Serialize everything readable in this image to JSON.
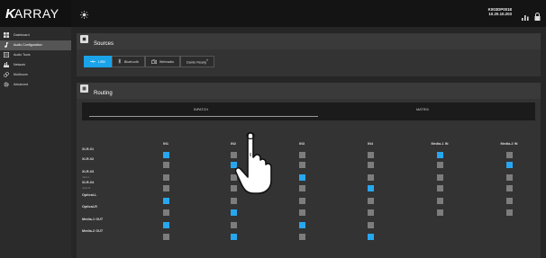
{
  "app": {
    "logo_k": "K",
    "logo_rest": "ARRAY"
  },
  "sidebar": {
    "items": [
      {
        "label": "Dashboard",
        "icon": "dashboard-icon",
        "active": false
      },
      {
        "label": "Audio Configuration",
        "icon": "music-note-icon",
        "active": true
      },
      {
        "label": "Audio Tools",
        "icon": "tools-icon",
        "active": false
      },
      {
        "label": "Network",
        "icon": "network-icon",
        "active": false
      },
      {
        "label": "Multiroom",
        "icon": "link-icon",
        "active": false
      },
      {
        "label": "Advanced",
        "icon": "gear-icon",
        "active": false
      }
    ]
  },
  "topbar": {
    "device_name": "K003DP0018",
    "device_ip": "10.20.10.203"
  },
  "sources": {
    "title": "Sources",
    "tabs": [
      {
        "label": "USB",
        "active": true
      },
      {
        "label": "Bluetooth",
        "active": false
      },
      {
        "label": "Webradio",
        "active": false
      },
      {
        "label": "Dante Ready",
        "active": false
      }
    ]
  },
  "routing": {
    "title": "Routing",
    "tabs": [
      "INPATCH",
      "MATRIX"
    ],
    "columns": [
      "IN1",
      "IN2",
      "IN3",
      "IN4",
      "Media-1 IN",
      "Media-2 IN"
    ],
    "rows": [
      {
        "label": "XLR-01",
        "sub": "",
        "cells": [
          1,
          0,
          0,
          0,
          1,
          0
        ]
      },
      {
        "label": "XLR-02",
        "sub": "",
        "cells": [
          0,
          1,
          0,
          0,
          0,
          1
        ]
      },
      {
        "label": "XLR-03",
        "sub": "Jack-L",
        "cells": [
          0,
          0,
          1,
          0,
          0,
          0
        ]
      },
      {
        "label": "XLR-04",
        "sub": "Jack-R",
        "cells": [
          0,
          0,
          0,
          1,
          0,
          0
        ]
      },
      {
        "label": "Optical-L",
        "sub": "",
        "cells": [
          1,
          0,
          0,
          0,
          0,
          0
        ]
      },
      {
        "label": "Optical-R",
        "sub": "",
        "cells": [
          0,
          1,
          0,
          0,
          0,
          0
        ]
      },
      {
        "label": "Media-1 OUT",
        "sub": "",
        "cells": [
          1,
          0,
          1,
          0,
          null,
          null
        ]
      },
      {
        "label": "Media-2 OUT",
        "sub": "",
        "cells": [
          0,
          1,
          0,
          1,
          null,
          null
        ]
      }
    ]
  },
  "colors": {
    "accent": "#27a7ef",
    "cell_off": "#7d7d7d"
  }
}
